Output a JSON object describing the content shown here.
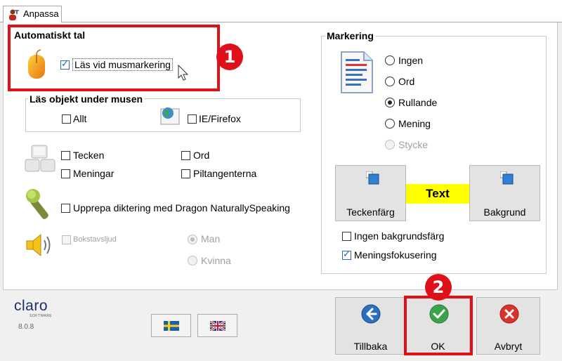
{
  "tab": {
    "label": "Anpassa"
  },
  "auto_speech": {
    "title": "Automatiskt tal",
    "read_on_mouse_select": {
      "label": "Läs vid musmarkering",
      "checked": true
    },
    "badge": "1"
  },
  "read_objects": {
    "title": "Läs objekt under musen",
    "all": {
      "label": "Allt",
      "checked": false
    },
    "ie_firefox": {
      "label": "IE/Firefox",
      "checked": false
    }
  },
  "keyboard": {
    "characters": {
      "label": "Tecken",
      "checked": false
    },
    "words": {
      "label": "Ord",
      "checked": false
    },
    "sentences": {
      "label": "Meningar",
      "checked": false
    },
    "arrow_keys": {
      "label": "Piltangenterna",
      "checked": false
    }
  },
  "dictation": {
    "label": "Upprepa diktering med Dragon NaturallySpeaking",
    "checked": false
  },
  "voice": {
    "letter_sounds": {
      "label": "Bokstavsljud",
      "checked": false,
      "enabled": false
    },
    "man": {
      "label": "Man",
      "checked": true,
      "enabled": false
    },
    "woman": {
      "label": "Kvinna",
      "checked": false,
      "enabled": false
    }
  },
  "highlight": {
    "title": "Markering",
    "options": [
      {
        "label": "Ingen",
        "checked": false,
        "enabled": true
      },
      {
        "label": "Ord",
        "checked": false,
        "enabled": true
      },
      {
        "label": "Rullande",
        "checked": true,
        "enabled": true
      },
      {
        "label": "Mening",
        "checked": false,
        "enabled": true
      },
      {
        "label": "Stycke",
        "checked": false,
        "enabled": false
      }
    ],
    "text_color_button": "Teckenfärg",
    "preview_text": "Text",
    "preview_color": "#ffff00",
    "background_button": "Bakgrund",
    "no_bg_color": {
      "label": "Ingen bakgrundsfärg",
      "checked": false
    },
    "sentence_focus": {
      "label": "Meningsfokusering",
      "checked": true
    }
  },
  "footer": {
    "logo": "claro",
    "logo_sub": "SOFTWARE",
    "version": "8.0.8",
    "back_button": "Tillbaka",
    "ok_button": "OK",
    "cancel_button": "Avbryt",
    "badge": "2"
  },
  "colors": {
    "annotation_red": "#e0101a",
    "accent_blue": "#2a6cc4"
  }
}
